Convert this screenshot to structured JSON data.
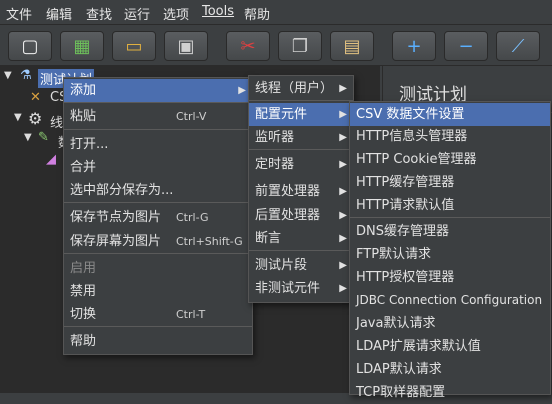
{
  "menubar": [
    "文件",
    "编辑",
    "查找",
    "运行",
    "选项",
    "Tools",
    "帮助"
  ],
  "toolbar": [
    {
      "icon": "new-document-icon",
      "glyph": "▢",
      "color": "#f0f0f0"
    },
    {
      "icon": "templates-icon",
      "glyph": "▦",
      "color": "#6dbf5a"
    },
    {
      "icon": "open-folder-icon",
      "glyph": "▭",
      "color": "#e0b040"
    },
    {
      "icon": "save-icon",
      "glyph": "▣",
      "color": "#d0d0d0"
    },
    {
      "icon": "cut-icon",
      "glyph": "✂",
      "color": "#e04040"
    },
    {
      "icon": "copy-icon",
      "glyph": "❐",
      "color": "#d0d0d0"
    },
    {
      "icon": "paste-icon",
      "glyph": "▤",
      "color": "#e0c080"
    },
    {
      "icon": "expand-icon",
      "glyph": "+",
      "color": "#5ab0ff"
    },
    {
      "icon": "collapse-icon",
      "glyph": "−",
      "color": "#5ab0ff"
    },
    {
      "icon": "toggle-icon",
      "glyph": "⟋",
      "color": "#7ac0ff"
    }
  ],
  "tree": {
    "root": "测试计划",
    "child1": "CS",
    "child2": "线",
    "child3": "数"
  },
  "right_panel": {
    "title": "测试计划"
  },
  "context_menu": {
    "items": [
      {
        "label": "添加",
        "shortcut": "",
        "submenu": true,
        "highlighted": true,
        "disabled": false
      },
      {
        "label": "粘贴",
        "shortcut": "Ctrl-V",
        "submenu": false,
        "highlighted": false,
        "disabled": false
      },
      {
        "label": "打开...",
        "shortcut": "",
        "submenu": false,
        "highlighted": false,
        "disabled": false
      },
      {
        "label": "合并",
        "shortcut": "",
        "submenu": false,
        "highlighted": false,
        "disabled": false
      },
      {
        "label": "选中部分保存为...",
        "shortcut": "",
        "submenu": false,
        "highlighted": false,
        "disabled": false
      },
      {
        "label": "保存节点为图片",
        "shortcut": "Ctrl-G",
        "submenu": false,
        "highlighted": false,
        "disabled": false
      },
      {
        "label": "保存屏幕为图片",
        "shortcut": "Ctrl+Shift-G",
        "submenu": false,
        "highlighted": false,
        "disabled": false
      },
      {
        "label": "启用",
        "shortcut": "",
        "submenu": false,
        "highlighted": false,
        "disabled": true
      },
      {
        "label": "禁用",
        "shortcut": "",
        "submenu": false,
        "highlighted": false,
        "disabled": false
      },
      {
        "label": "切换",
        "shortcut": "Ctrl-T",
        "submenu": false,
        "highlighted": false,
        "disabled": false
      },
      {
        "label": "帮助",
        "shortcut": "",
        "submenu": false,
        "highlighted": false,
        "disabled": false
      }
    ]
  },
  "add_submenu": {
    "items": [
      {
        "label": "线程（用户）",
        "highlighted": false
      },
      {
        "label": "配置元件",
        "highlighted": true
      },
      {
        "label": "监听器",
        "highlighted": false
      },
      {
        "label": "定时器",
        "highlighted": false
      },
      {
        "label": "前置处理器",
        "highlighted": false
      },
      {
        "label": "后置处理器",
        "highlighted": false
      },
      {
        "label": "断言",
        "highlighted": false
      },
      {
        "label": "测试片段",
        "highlighted": false
      },
      {
        "label": "非测试元件",
        "highlighted": false
      }
    ]
  },
  "config_submenu": {
    "items": [
      {
        "label": "CSV 数据文件设置",
        "highlighted": true
      },
      {
        "label": "HTTP信息头管理器",
        "highlighted": false
      },
      {
        "label": "HTTP Cookie管理器",
        "highlighted": false
      },
      {
        "label": "HTTP缓存管理器",
        "highlighted": false
      },
      {
        "label": "HTTP请求默认值",
        "highlighted": false
      },
      {
        "label": "DNS缓存管理器",
        "highlighted": false
      },
      {
        "label": "FTP默认请求",
        "highlighted": false
      },
      {
        "label": "HTTP授权管理器",
        "highlighted": false
      },
      {
        "label": "JDBC Connection Configuration",
        "highlighted": false
      },
      {
        "label": "Java默认请求",
        "highlighted": false
      },
      {
        "label": "LDAP扩展请求默认值",
        "highlighted": false
      },
      {
        "label": "LDAP默认请求",
        "highlighted": false
      },
      {
        "label": "TCP取样器配置",
        "highlighted": false
      }
    ]
  },
  "colors": {
    "highlight": "#4b6eaf",
    "background": "#3c3f41",
    "tree_bg": "#2b2b2b"
  }
}
